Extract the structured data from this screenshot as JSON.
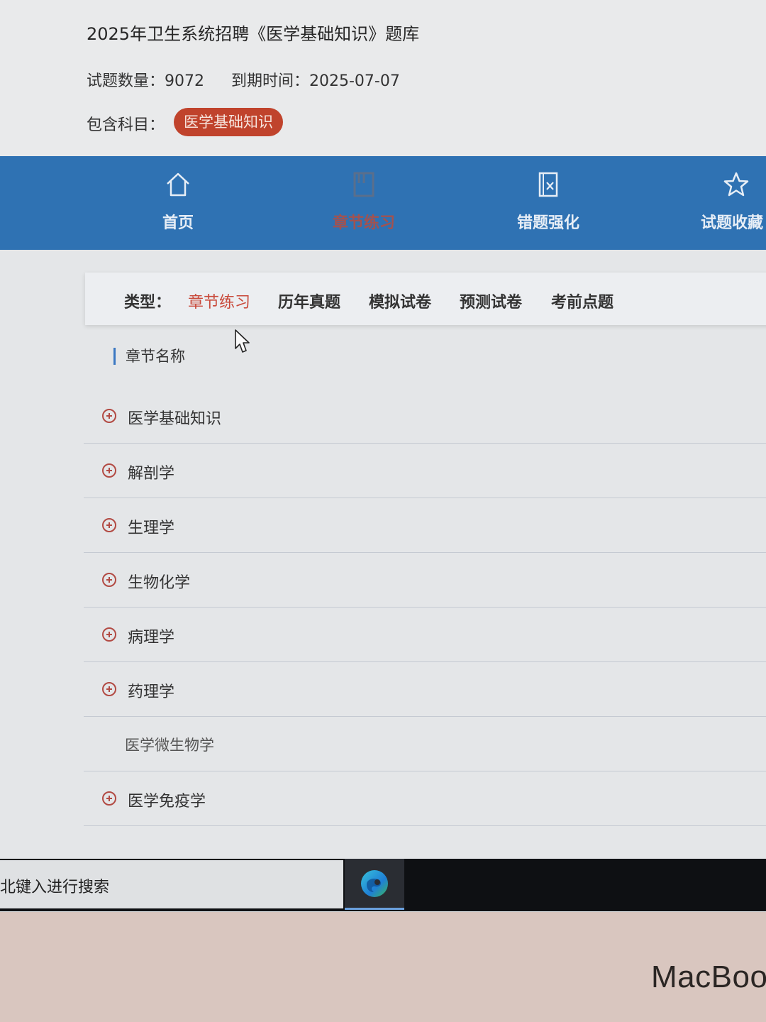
{
  "header": {
    "title": "2025年卫生系统招聘《医学基础知识》题库",
    "question_count": "试题数量：9072",
    "expiry": "到期时间：2025-07-07",
    "subjects_label": "包含科目：",
    "subject_tag": "医学基础知识"
  },
  "nav": {
    "items": [
      {
        "label": "首页",
        "icon": "home-icon"
      },
      {
        "label": "章节练习",
        "icon": "book-icon",
        "active": true
      },
      {
        "label": "错题强化",
        "icon": "wrong-answer-icon"
      },
      {
        "label": "试题收藏",
        "icon": "star-icon"
      }
    ]
  },
  "type_filter": {
    "label": "类型：",
    "options": [
      "章节练习",
      "历年真题",
      "模拟试卷",
      "预测试卷",
      "考前点题"
    ],
    "selected": "章节练习"
  },
  "chapters": {
    "section_title": "章节名称",
    "items": [
      {
        "name": "医学基础知识",
        "expandable": true
      },
      {
        "name": "解剖学",
        "expandable": true
      },
      {
        "name": "生理学",
        "expandable": true
      },
      {
        "name": "生物化学",
        "expandable": true
      },
      {
        "name": "病理学",
        "expandable": true
      },
      {
        "name": "药理学",
        "expandable": true
      },
      {
        "name": "医学微生物学",
        "expandable": false
      },
      {
        "name": "医学免疫学",
        "expandable": true
      }
    ]
  },
  "taskbar": {
    "search_text": "北键入进行搜索",
    "pinned_app": "edge-icon"
  },
  "bezel": {
    "brand": "MacBoo"
  },
  "colors": {
    "nav_bg": "#2f72b3",
    "accent_red": "#c9493a",
    "tag_bg": "#c0432c"
  }
}
